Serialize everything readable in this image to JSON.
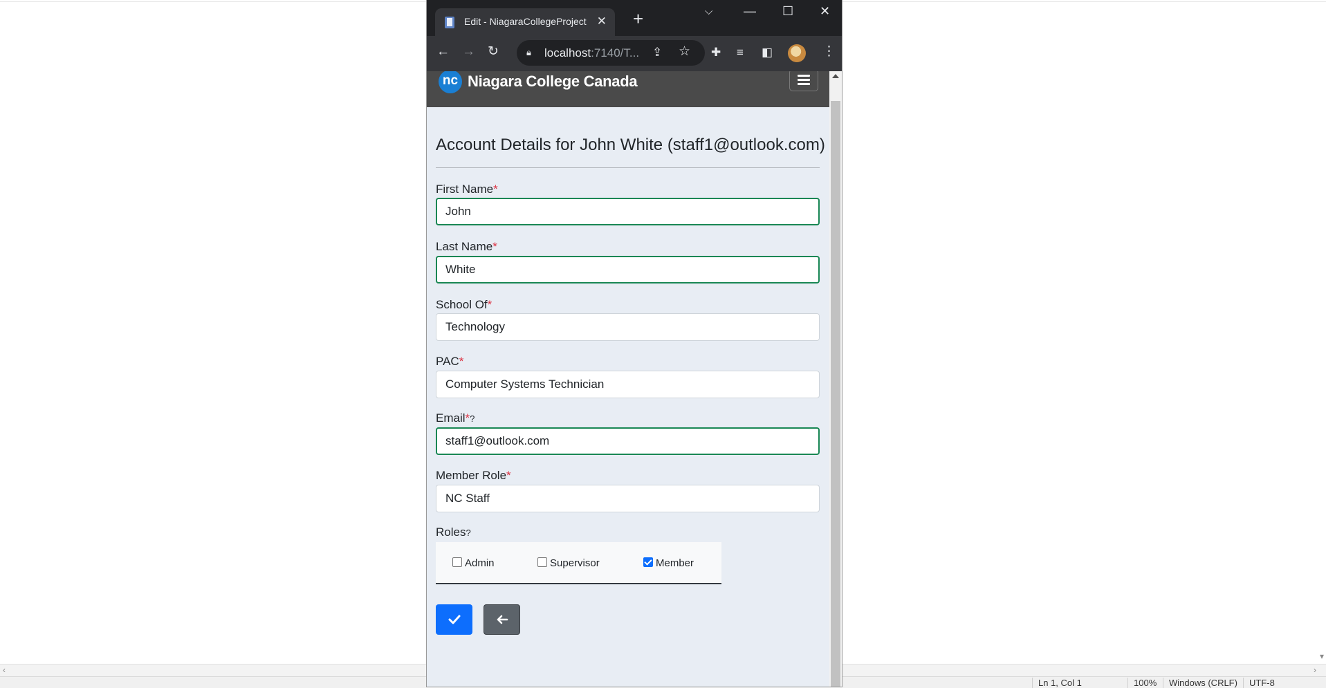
{
  "browser": {
    "tab_title": "Edit - NiagaraCollegeProject",
    "url_host": "localhost",
    "url_rest": ":7140/T...",
    "window_controls": [
      "chevron-down-icon",
      "minimize-icon",
      "maximize-icon",
      "close-icon"
    ]
  },
  "navbar": {
    "logo_text": "nc",
    "brand": "Niagara College Canada"
  },
  "form": {
    "heading": "Account Details for John White (staff1@outlook.com)",
    "required_mark": "*",
    "help_mark": "?",
    "first_name": {
      "label": "First Name",
      "value": "John"
    },
    "last_name": {
      "label": "Last Name",
      "value": "White"
    },
    "school_of": {
      "label": "School Of",
      "value": "Technology"
    },
    "pac": {
      "label": "PAC",
      "value": "Computer Systems Technician"
    },
    "email": {
      "label": "Email",
      "value": "staff1@outlook.com"
    },
    "member_role": {
      "label": "Member Role",
      "value": "NC Staff"
    },
    "roles": {
      "label": "Roles",
      "options": [
        {
          "label": "Admin",
          "checked": false
        },
        {
          "label": "Supervisor",
          "checked": false
        },
        {
          "label": "Member",
          "checked": true
        }
      ]
    }
  },
  "status_bar": {
    "position": "Ln 1, Col 1",
    "zoom": "100%",
    "line_ending": "Windows (CRLF)",
    "encoding": "UTF-8"
  },
  "colors": {
    "accent": "#0d6efd",
    "valid_border": "#198754",
    "required": "#dc3545",
    "navbar": "#4a4a4a"
  }
}
